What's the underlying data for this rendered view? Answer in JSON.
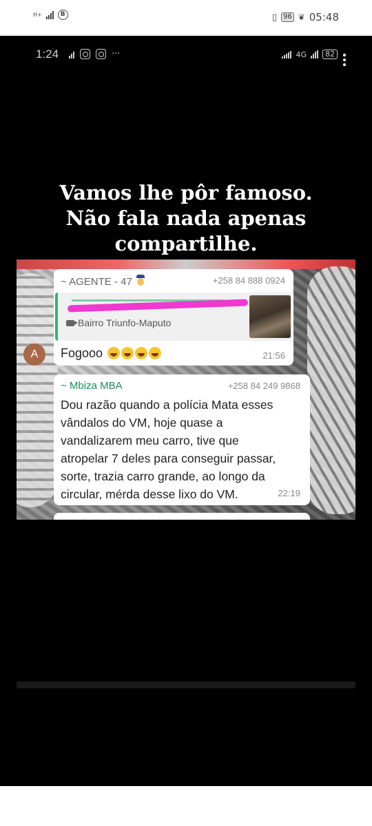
{
  "outer_status": {
    "network_badge": "H+",
    "battery": "96",
    "time": "05:48"
  },
  "inner_status": {
    "time": "1:24",
    "more_indicator": "···",
    "network": "4G",
    "battery": "82"
  },
  "headline": {
    "line1": "Vamos lhe pôr famoso.",
    "line2": "Não fala nada apenas",
    "line3": "compartilhe."
  },
  "chat": {
    "message1": {
      "sender": "~ AGENTE - 47",
      "phone": "+258 84 888 0924",
      "quoted_location": "Bairro Triunfo-Maputo",
      "text": "Fogooo",
      "time": "21:56",
      "avatar_letter": "A"
    },
    "message2": {
      "sender": "~ Mbiza MBA",
      "phone": "+258 84 249 9868",
      "line1": "Dou razão quando a polícia Mata esses",
      "line2": "vândalos do VM, hoje quase a",
      "line3": "vandalizarem meu carro, tive que",
      "line4": "atropelar 7 deles para conseguir passar,",
      "line5": "sorte, trazia carro grande,  ao longo da",
      "line6": "circular, mérda desse lixo do VM.",
      "time": "22:19"
    }
  },
  "icons": {
    "signal": "signal-bars-icon",
    "notification": "b-circle-icon",
    "vibrate": "vibrate-icon",
    "leaf": "leaf-icon",
    "instagram": "instagram-icon",
    "video": "video-icon",
    "emoji": "tears-of-joy-emoji",
    "police": "police-officer-emoji",
    "more": "kebab-menu-icon"
  }
}
